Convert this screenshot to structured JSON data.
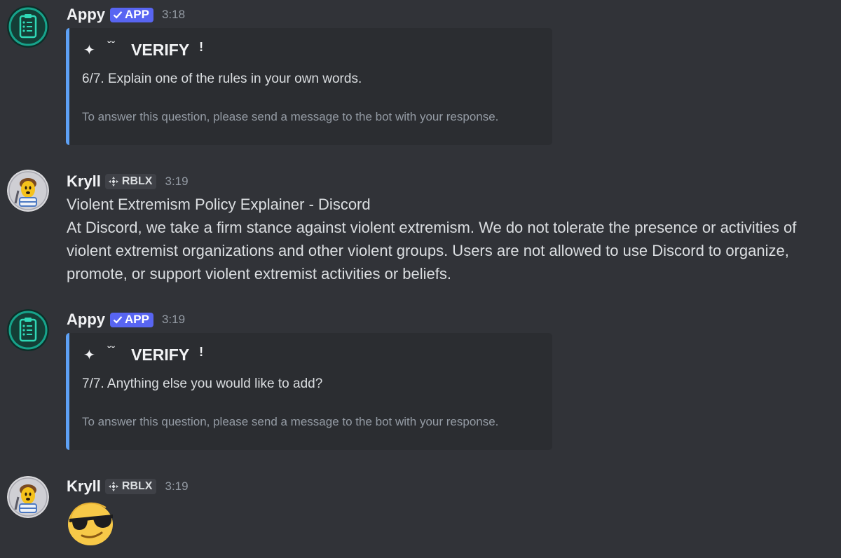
{
  "messages": [
    {
      "author": "Appy",
      "tag": "APP",
      "time": "3:18",
      "embed": {
        "spark": "✦",
        "kaomoji": "˘˘",
        "title": "VERIFY",
        "bang": "!",
        "description": "6/7. Explain one of the rules in your own words.",
        "footer": "To answer this question, please send a message to the bot with your response."
      }
    },
    {
      "author": "Kryll",
      "role": "RBLX",
      "time": "3:19",
      "lines": [
        "Violent Extremism Policy Explainer - Discord",
        "At Discord, we take a firm stance against violent extremism. We do not tolerate the presence or activities of",
        "violent extremist organizations and other violent groups. Users are not allowed to use Discord to organize,",
        "promote, or support violent extremist activities or beliefs."
      ]
    },
    {
      "author": "Appy",
      "tag": "APP",
      "time": "3:19",
      "embed": {
        "spark": "✦",
        "kaomoji": "˘˘",
        "title": "VERIFY",
        "bang": "!",
        "description": "7/7. Anything else you would like to add?",
        "footer": "To answer this question, please send a message to the bot with your response."
      }
    },
    {
      "author": "Kryll",
      "role": "RBLX",
      "time": "3:19",
      "emoji": "sunglasses-emoji"
    }
  ],
  "colors": {
    "background": "#313338",
    "embed_bg": "#2b2d31",
    "embed_border": "#5ea1f5",
    "app_tag": "#5865f2",
    "appy_avatar": "#17a38b",
    "timestamp": "#949ba4"
  },
  "icons": {
    "appy_avatar": "clipboard-checklist-icon",
    "kryll_avatar": "cartoon-character-avatar",
    "app_verified": "checkmark-icon",
    "role_icon": "diamond-arrows-icon"
  }
}
